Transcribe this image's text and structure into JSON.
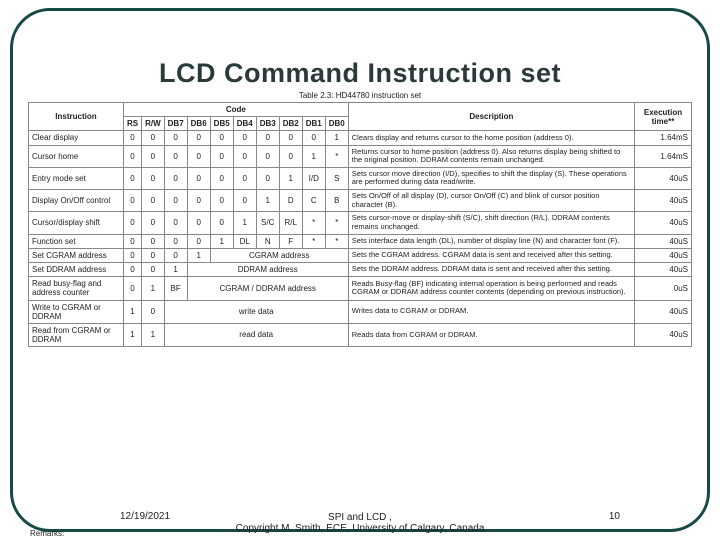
{
  "title": "LCD Command Instruction set",
  "caption": "Table 2.3: HD44780 instruction set",
  "headers": {
    "instruction": "Instruction",
    "code": "Code",
    "description": "Description",
    "execution": "Execution time**",
    "bits": [
      "RS",
      "R/W",
      "DB7",
      "DB6",
      "DB5",
      "DB4",
      "DB3",
      "DB2",
      "DB1",
      "DB0"
    ]
  },
  "rows": [
    {
      "label": "Clear display",
      "bits": [
        "0",
        "0",
        "0",
        "0",
        "0",
        "0",
        "0",
        "0",
        "0",
        "1"
      ],
      "desc": "Clears display and returns cursor to the home position (address 0).",
      "exec": "1.64mS"
    },
    {
      "label": "Cursor home",
      "bits": [
        "0",
        "0",
        "0",
        "0",
        "0",
        "0",
        "0",
        "0",
        "1",
        "*"
      ],
      "desc": "Returns cursor to home position (address 0). Also returns display being shifted to the original position. DDRAM contents remain unchanged.",
      "exec": "1.64mS"
    },
    {
      "label": "Entry mode set",
      "bits": [
        "0",
        "0",
        "0",
        "0",
        "0",
        "0",
        "0",
        "1",
        "I/D",
        "S"
      ],
      "desc": "Sets cursor move direction (I/D), specifies to shift the display (S). These operations are performed during data read/write.",
      "exec": "40uS"
    },
    {
      "label": "Display On/Off control",
      "bits": [
        "0",
        "0",
        "0",
        "0",
        "0",
        "0",
        "1",
        "D",
        "C",
        "B"
      ],
      "desc": "Sets On/Off of all display (D), cursor On/Off (C) and blink of cursor position character (B).",
      "exec": "40uS"
    },
    {
      "label": "Cursor/display shift",
      "bits": [
        "0",
        "0",
        "0",
        "0",
        "0",
        "1",
        "S/C",
        "R/L",
        "*",
        "*"
      ],
      "desc": "Sets cursor-move or display-shift (S/C), shift direction (R/L). DDRAM contents remains unchanged.",
      "exec": "40uS"
    },
    {
      "label": "Function set",
      "bits": [
        "0",
        "0",
        "0",
        "0",
        "1",
        "DL",
        "N",
        "F",
        "*",
        "*"
      ],
      "desc": "Sets interface data length (DL), number of display line (N) and character font (F).",
      "exec": "40uS"
    },
    {
      "label": "Set CGRAM address",
      "bits": [
        "0",
        "0",
        "0",
        "1"
      ],
      "merged": "CGRAM address",
      "merged_span": 6,
      "desc": "Sets the CGRAM address. CGRAM data is sent and received after this setting.",
      "exec": "40uS"
    },
    {
      "label": "Set DDRAM address",
      "bits": [
        "0",
        "0",
        "1"
      ],
      "merged": "DDRAM address",
      "merged_span": 7,
      "desc": "Sets the DDRAM address. DDRAM data is sent and received after this setting.",
      "exec": "40uS"
    },
    {
      "label": "Read busy-flag and address counter",
      "bits": [
        "0",
        "1",
        "BF"
      ],
      "merged": "CGRAM / DDRAM address",
      "merged_span": 7,
      "desc": "Reads Busy-flag (BF) indicating internal operation is being performed and reads CGRAM or DDRAM address counter contents (depending on previous instruction).",
      "exec": "0uS"
    },
    {
      "label": "Write to CGRAM or DDRAM",
      "bits": [
        "1",
        "0"
      ],
      "merged": "write data",
      "merged_span": 8,
      "desc": "Writes data to CGRAM or DDRAM.",
      "exec": "40uS"
    },
    {
      "label": "Read from CGRAM or DDRAM",
      "bits": [
        "1",
        "1"
      ],
      "merged": "read data",
      "merged_span": 8,
      "desc": "Reads data from CGRAM or DDRAM.",
      "exec": "40uS"
    }
  ],
  "remarks": "Remarks:",
  "footer": {
    "date": "12/19/2021",
    "center_line1": "SPI and LCD ,",
    "center_line2": "Copyright M. Smith, ECE, University of Calgary, Canada",
    "page": "10"
  }
}
